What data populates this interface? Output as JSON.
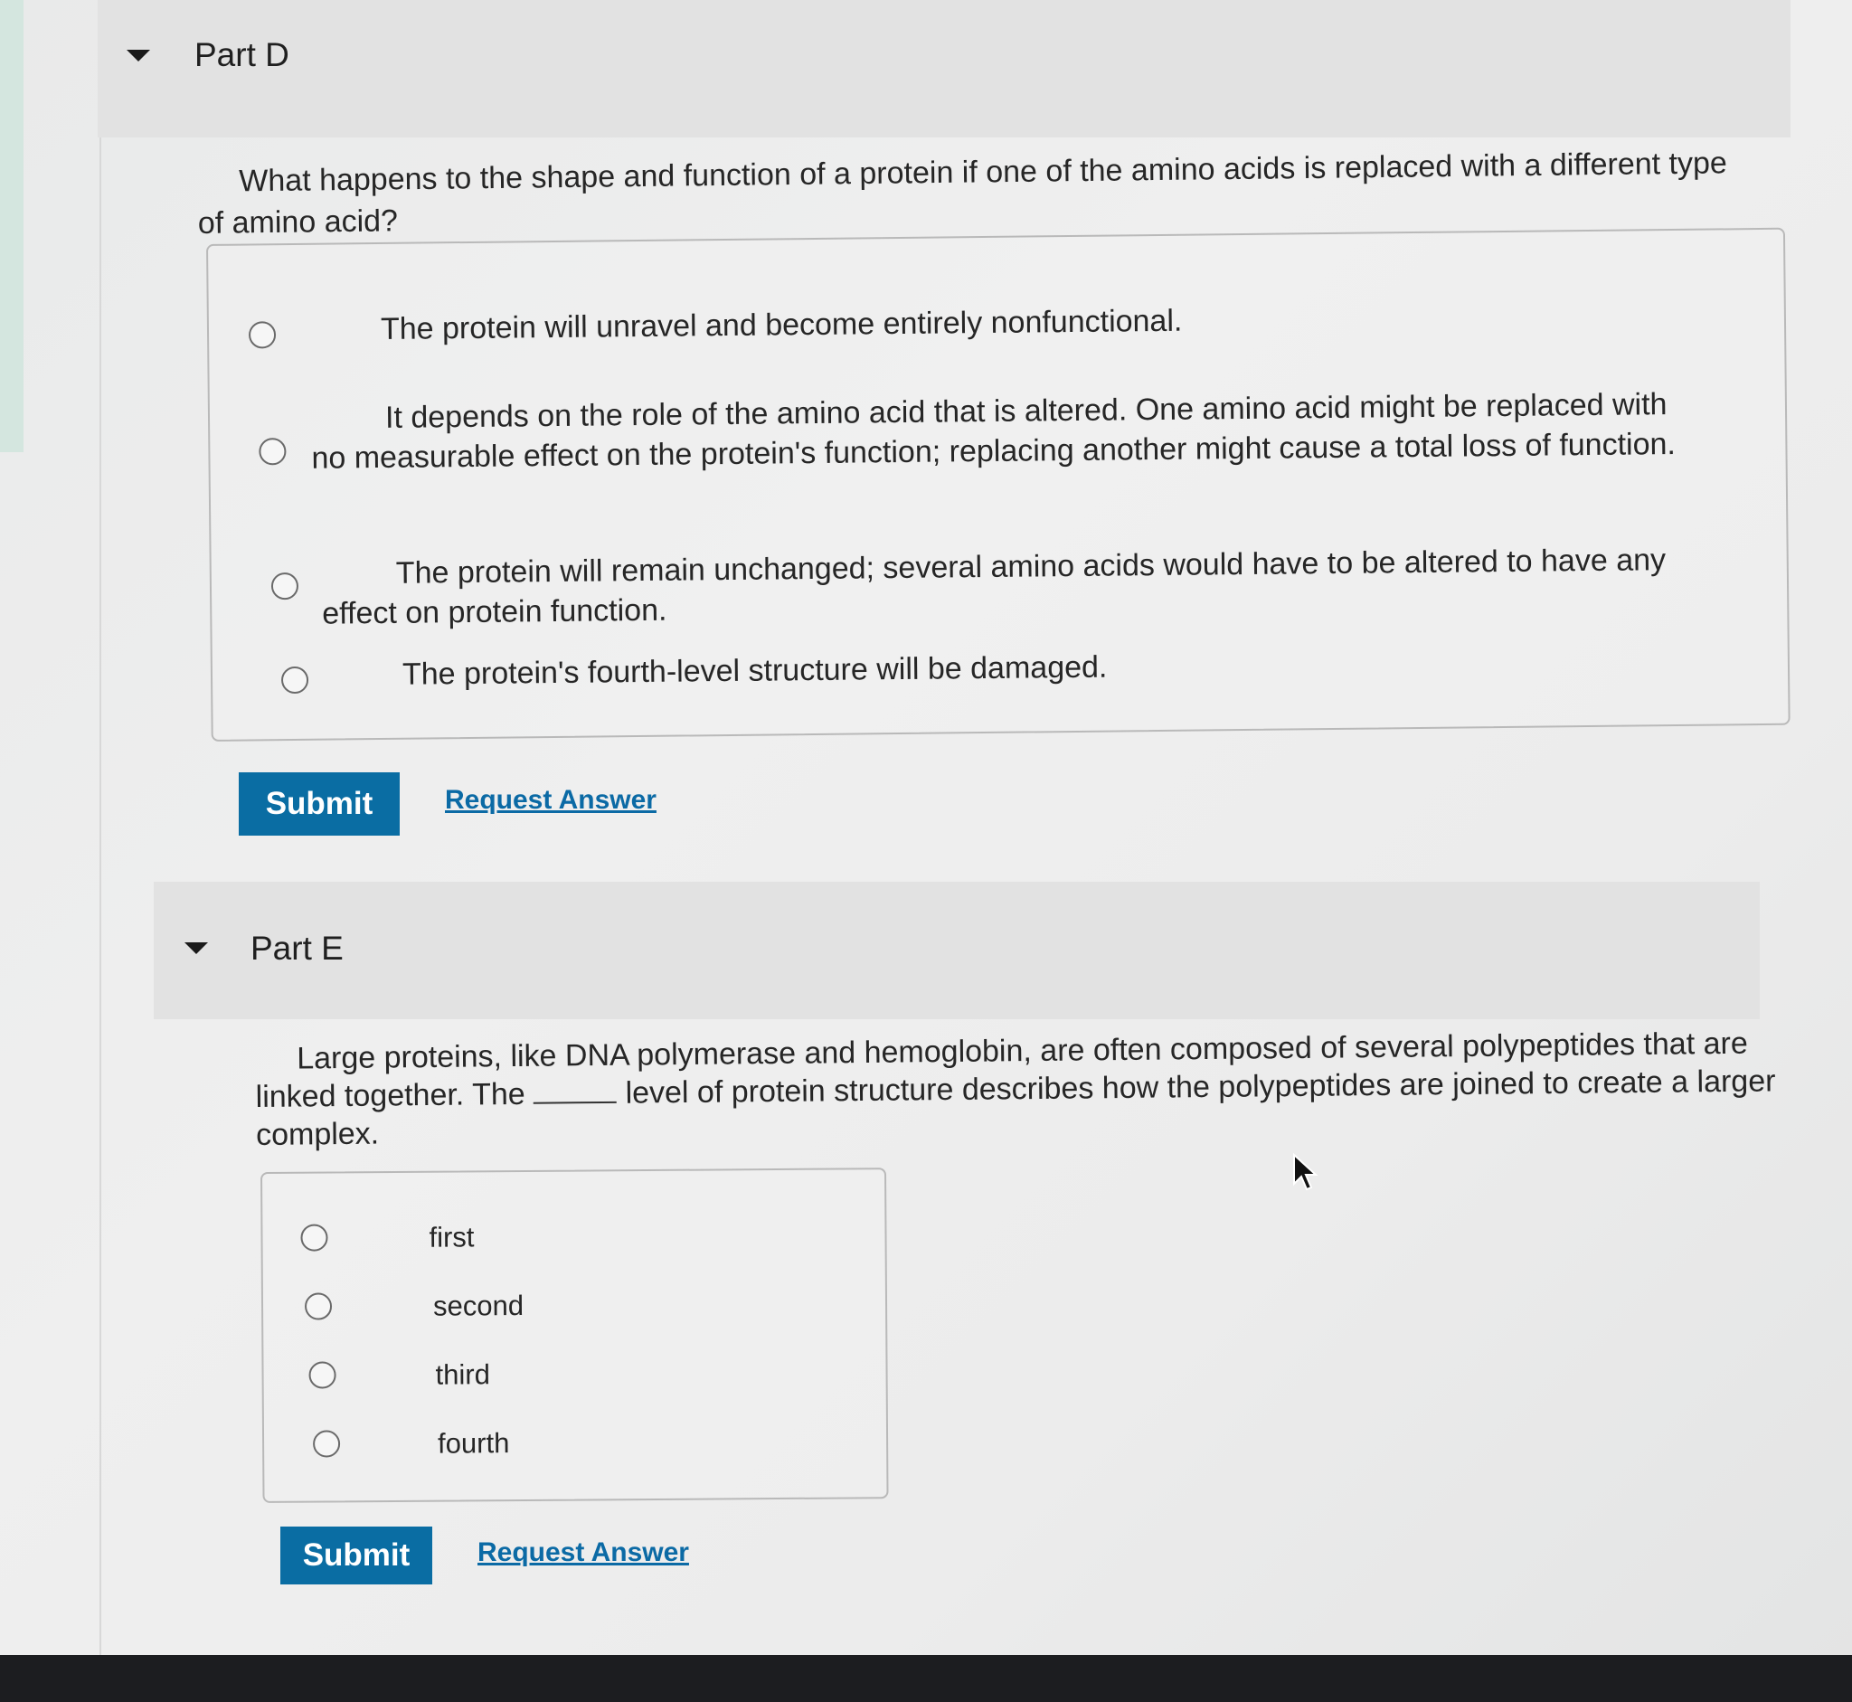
{
  "part_d": {
    "title": "Part D",
    "question_line1": "What happens to the shape and function of a protein if one of the amino acids is replaced with a different type",
    "question_line2": "of amino acid?",
    "choices": [
      {
        "lines": [
          "The protein will unravel and become entirely nonfunctional."
        ]
      },
      {
        "lines": [
          "It depends on the role of the amino acid that is altered. One amino acid might be replaced with",
          "no measurable effect on the protein's function; replacing another might cause a total loss of function."
        ]
      },
      {
        "lines": [
          "The protein will remain unchanged; several amino acids would have to be altered to have any",
          "effect on protein function."
        ]
      },
      {
        "lines": [
          "The protein's fourth-level structure will be damaged."
        ]
      }
    ],
    "submit_label": "Submit",
    "request_answer_label": "Request Answer"
  },
  "part_e": {
    "title": "Part E",
    "question_line1": "Large proteins, like DNA polymerase and hemoglobin, are often composed of several polypeptides that are",
    "question_line2_before": "linked together. The",
    "question_line2_after": "level of protein structure describes how the polypeptides are joined to create a larger",
    "question_line3": "complex.",
    "choices": [
      "first",
      "second",
      "third",
      "fourth"
    ],
    "submit_label": "Submit",
    "request_answer_label": "Request Answer"
  },
  "icons": {
    "collapse": "caret-down-icon",
    "pointer": "mouse-pointer-icon"
  }
}
